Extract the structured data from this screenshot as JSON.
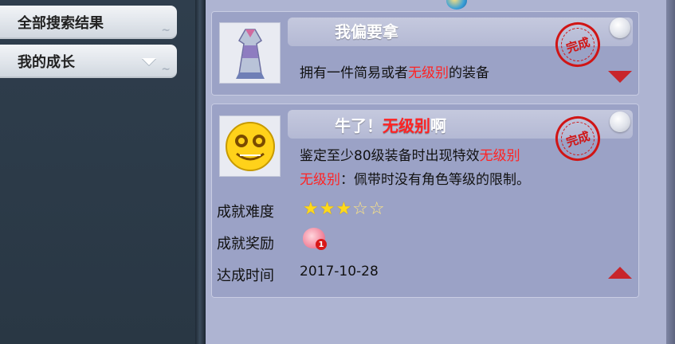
{
  "sidebar": {
    "items": [
      {
        "label": "全部搜索结果"
      },
      {
        "label": "我的成长"
      }
    ]
  },
  "achievements": [
    {
      "title": "我偏要拿",
      "desc_parts": [
        "拥有一件简易或者",
        "无级别",
        "的装备"
      ],
      "stamp_text": "完成",
      "icon": "robe-equipment-icon"
    },
    {
      "title_parts": [
        "牛了！",
        "无级别",
        "啊"
      ],
      "desc_line1_parts": [
        "鉴定至少80级装备时出现特效",
        "无级别"
      ],
      "desc_line2_parts": [
        "无级别",
        "：佩带时没有角色等级的限制。"
      ],
      "stamp_text": "完成",
      "icon": "smiley-coin-face-icon",
      "difficulty_label": "成就难度",
      "difficulty_stars": 3,
      "difficulty_max": 5,
      "stars_text": {
        "full": "★★★",
        "empty": "☆☆"
      },
      "reward_label": "成就奖励",
      "reward_badge": "1",
      "time_label": "达成时间",
      "time_value": "2017-10-28"
    }
  ],
  "colors": {
    "highlight": "#ff2323",
    "stamp": "#d01515",
    "arrow": "#c8252b"
  }
}
